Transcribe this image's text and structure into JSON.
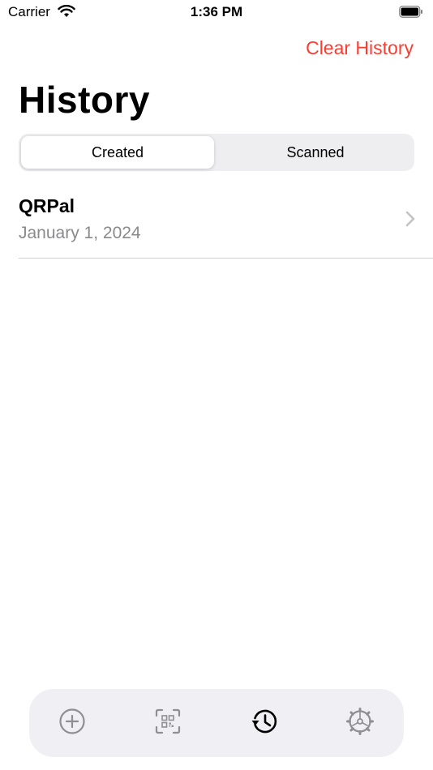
{
  "status_bar": {
    "carrier": "Carrier",
    "time": "1:36 PM"
  },
  "nav": {
    "clear_label": "Clear History"
  },
  "page": {
    "title": "History"
  },
  "segments": [
    {
      "label": "Created",
      "selected": true
    },
    {
      "label": "Scanned",
      "selected": false
    }
  ],
  "history": [
    {
      "title": "QRPal",
      "date": "January 1, 2024"
    }
  ],
  "tabbar": {
    "items": [
      {
        "icon": "plus-circle-icon",
        "selected": false
      },
      {
        "icon": "qr-scan-icon",
        "selected": false
      },
      {
        "icon": "history-clock-icon",
        "selected": true
      },
      {
        "icon": "gear-icon",
        "selected": false
      }
    ]
  },
  "colors": {
    "accent": "#ff3b30",
    "secondary_text": "#8a8a8e",
    "tab_inactive": "#8e8e93"
  }
}
